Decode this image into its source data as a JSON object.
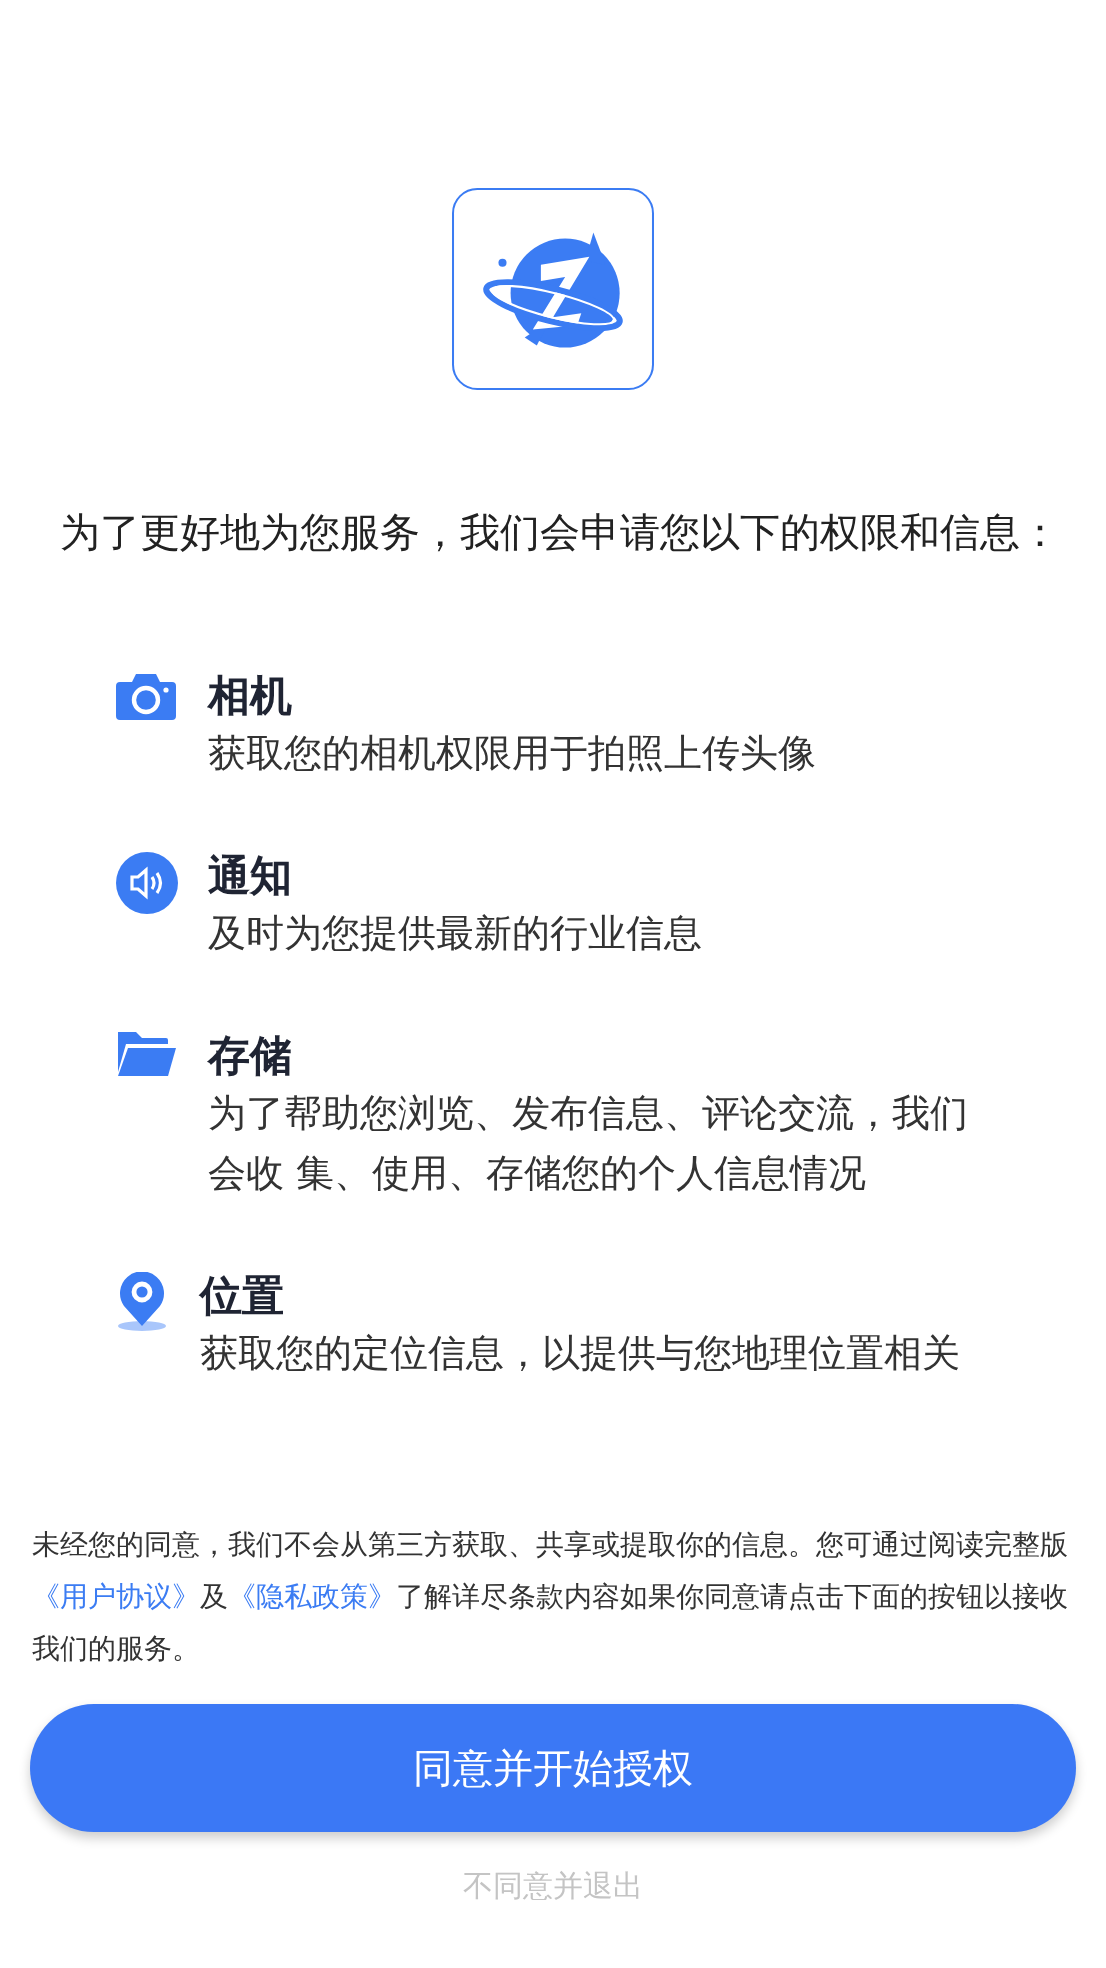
{
  "intro": "为了更好地为您服务，我们会申请您以下的权限和信息：",
  "permissions": [
    {
      "kind": "camera",
      "title": "相机",
      "description": "获取您的相机权限用于拍照上传头像"
    },
    {
      "kind": "notification",
      "title": "通知",
      "description": "及时为您提供最新的行业信息"
    },
    {
      "kind": "storage",
      "title": "存储",
      "description": "为了帮助您浏览、发布信息、评论交流，我们会收 集、使用、存储您的个人信息情况"
    },
    {
      "kind": "location",
      "title": "位置",
      "description": "获取您的定位信息，以提供与您地理位置相关"
    }
  ],
  "notice": [
    {
      "kind": "text",
      "text": "未经您的同意，我们不会从第三方获取、共享或提取你的信息。您可通过阅读完整版"
    },
    {
      "kind": "link",
      "text": "《用户协议》"
    },
    {
      "kind": "text",
      "text": "及"
    },
    {
      "kind": "link",
      "text": "《隐私政策》"
    },
    {
      "kind": "text",
      "text": "了解详尽条款内容如果你同意请点击下面的按钮以接收我们的服务。"
    }
  ],
  "agree_button": "同意并开始授权",
  "decline_link": "不同意并退出"
}
